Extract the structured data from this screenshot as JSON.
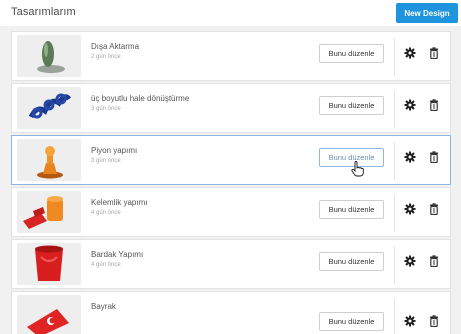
{
  "header": {
    "title": "Tasarımlarım",
    "new_design_label": "New Design"
  },
  "colors": {
    "accent": "#1e93de",
    "selected_border": "#8fb6e0"
  },
  "designs": [
    {
      "name": "Dışa Aktarma",
      "time": "2 gün önce",
      "edit_label": "Bunu düzenle",
      "thumb": "green-knob"
    },
    {
      "name": "üç boyutlu hale dönüştürme",
      "time": "3 gün önce",
      "edit_label": "Bunu düzenle",
      "thumb": "blue-twisted-chain"
    },
    {
      "name": "Piyon yapımı",
      "time": "3 gün önce",
      "edit_label": "Bunu düzenle",
      "thumb": "orange-pawn"
    },
    {
      "name": "Kelemlik yapımı",
      "time": "4 gün önce",
      "edit_label": "Bunu düzenle",
      "thumb": "orange-cup-red-blocks"
    },
    {
      "name": "Bardak Yapımı",
      "time": "4 gün önce",
      "edit_label": "Bunu düzenle",
      "thumb": "red-cup"
    },
    {
      "name": "Bayrak",
      "time": "",
      "edit_label": "Bunu düzenle",
      "thumb": "red-flag"
    }
  ],
  "icons": {
    "settings": "gear-icon",
    "delete": "trash-icon",
    "cursor": "hand-pointer-icon"
  }
}
